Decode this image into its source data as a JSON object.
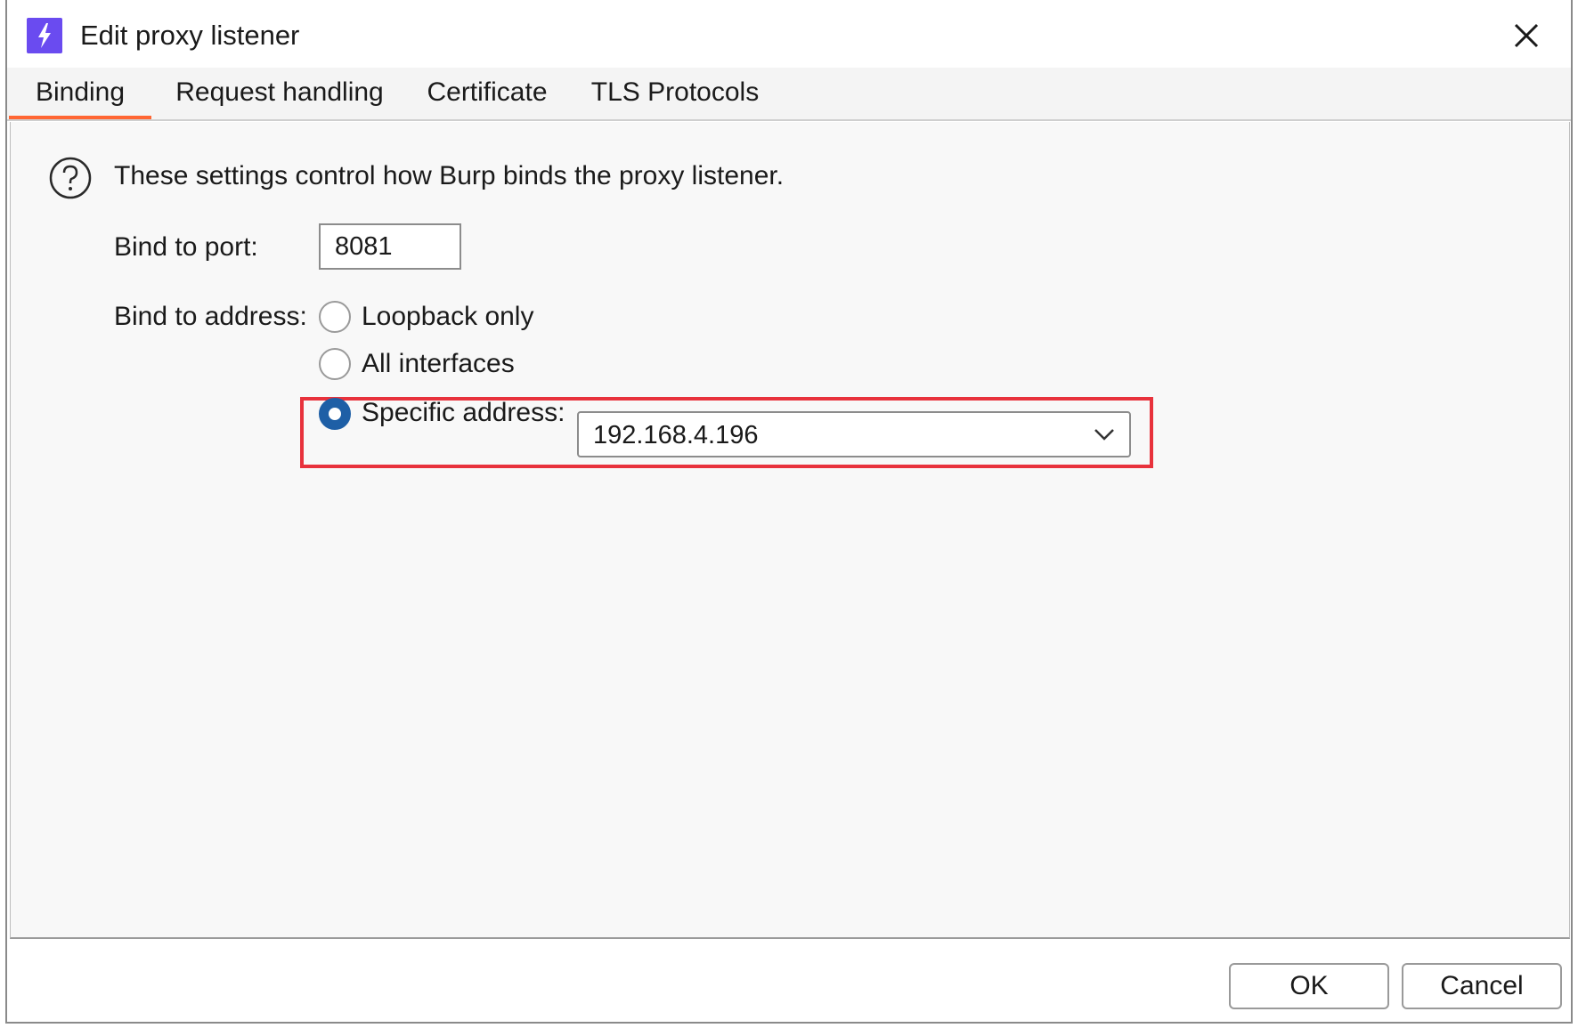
{
  "window": {
    "title": "Edit proxy listener",
    "app_icon": "burp-lightning-icon",
    "close_icon": "close-icon"
  },
  "tabs": [
    {
      "label": "Binding",
      "active": true
    },
    {
      "label": "Request handling",
      "active": false
    },
    {
      "label": "Certificate",
      "active": false
    },
    {
      "label": "TLS Protocols",
      "active": false
    }
  ],
  "binding": {
    "info_text": "These settings control how Burp binds the proxy listener.",
    "port_label": "Bind to port:",
    "port_value": "8081",
    "address_label": "Bind to address:",
    "options": [
      {
        "label": "Loopback only",
        "checked": false
      },
      {
        "label": "All interfaces",
        "checked": false
      },
      {
        "label": "Specific address:",
        "checked": true
      }
    ],
    "specific_address_value": "192.168.4.196"
  },
  "footer": {
    "ok_label": "OK",
    "cancel_label": "Cancel"
  },
  "colors": {
    "accent_tab": "#ff6633",
    "radio_selected": "#1e5fa6",
    "highlight_box": "#e8323c",
    "app_icon_bg": "#6a4bf0"
  }
}
